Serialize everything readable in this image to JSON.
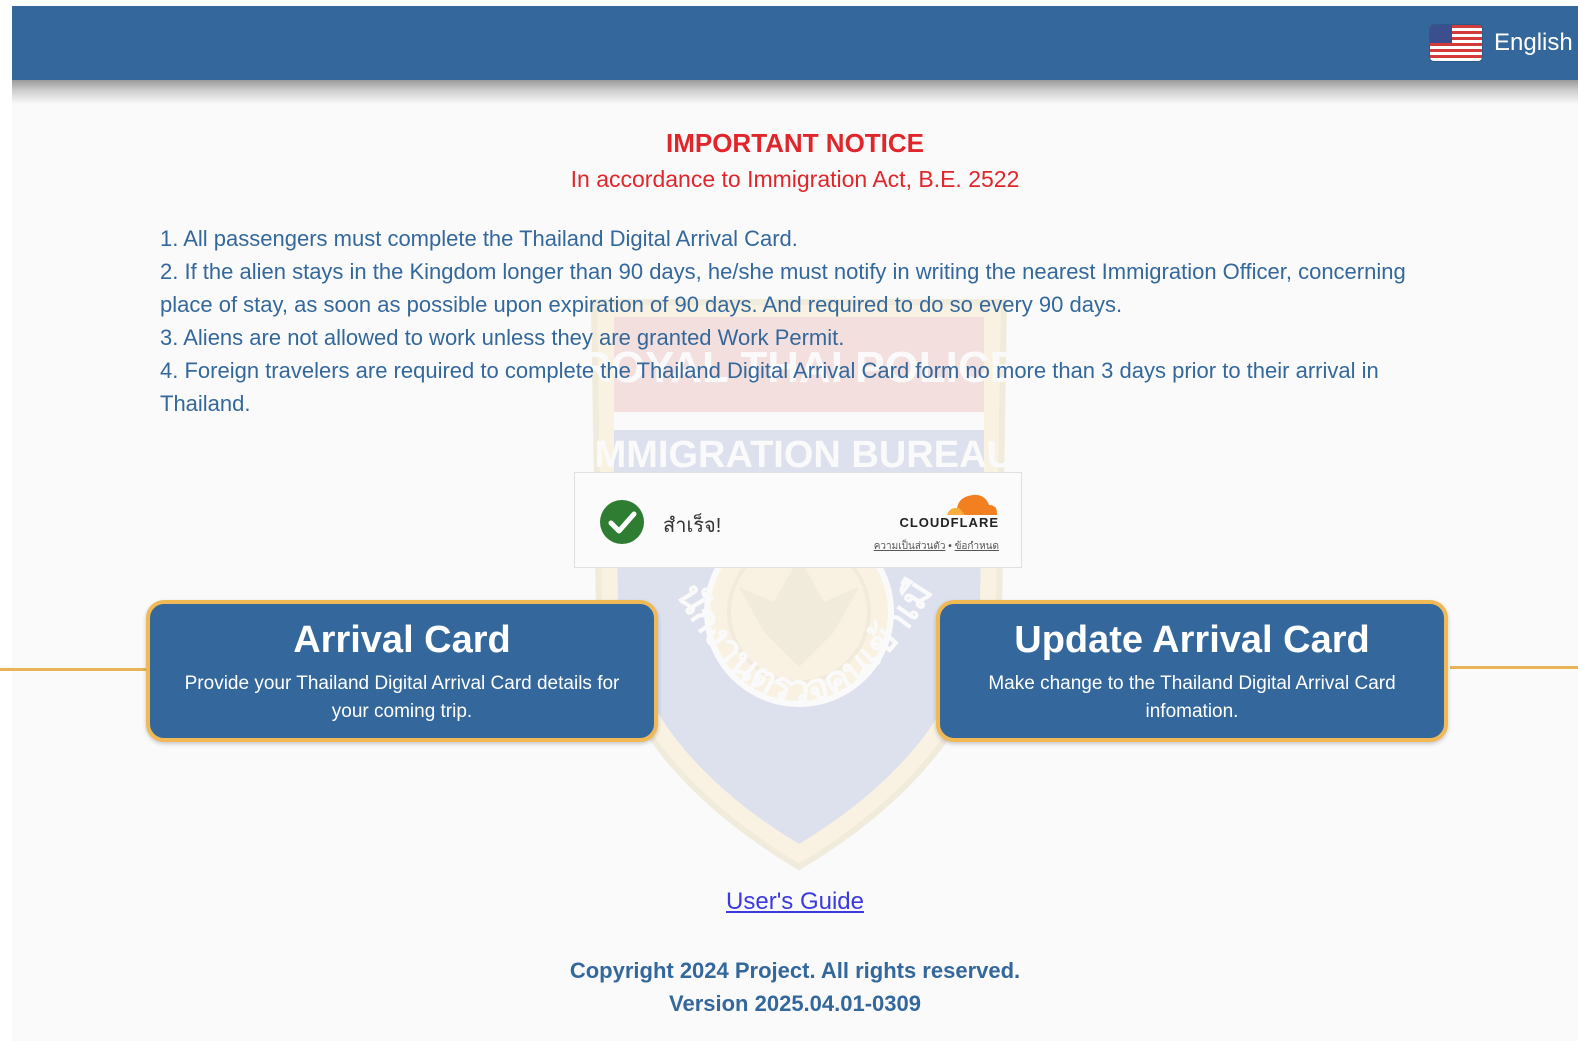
{
  "header": {
    "language_label": "English",
    "flag_icon": "us-flag-icon",
    "background_color": "#34689c"
  },
  "notice": {
    "title": "IMPORTANT NOTICE",
    "subtitle": "In accordance to Immigration Act, B.E. 2522",
    "rules": [
      "1. All passengers must complete the Thailand Digital Arrival Card.",
      "2. If the alien stays in the Kingdom longer than 90 days, he/she must notify in writing the nearest Immigration Officer, concerning place of stay, as soon as possible upon expiration of 90 days. And required to do so every 90 days.",
      "3. Aliens are not allowed to work unless they are granted Work Permit.",
      "4. Foreign travelers are required to complete the Thailand Digital Arrival Card form no more than 3 days prior to their arrival in Thailand."
    ],
    "title_color": "#e0262b",
    "text_color": "#34689c"
  },
  "watermark": {
    "line1": "ROYAL THAI POLICE",
    "line2": "IMMIGRATION BUREAU",
    "line3": "สำนักงานตรวจคนเข้าเมือง"
  },
  "captcha": {
    "status": "สำเร็จ!",
    "brand": "CLOUDFLARE",
    "link_privacy": "ความเป็นส่วนตัว",
    "link_separator": " • ",
    "link_terms": "ข้อกำหนด",
    "check_color": "#2e7d32",
    "cloud_color": "#f38020"
  },
  "cards": {
    "arrival": {
      "title": "Arrival Card",
      "description": "Provide your Thailand Digital Arrival Card details for your coming trip."
    },
    "update": {
      "title": "Update Arrival Card",
      "description": "Make change to the Thailand Digital Arrival Card infomation."
    },
    "border_color": "#f0b955"
  },
  "footer": {
    "guide_link": "User's Guide",
    "copyright": "Copyright 2024 Project. All rights reserved.",
    "version": "Version 2025.04.01-0309"
  }
}
